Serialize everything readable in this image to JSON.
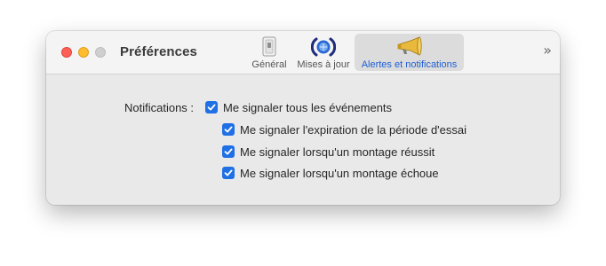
{
  "window": {
    "title": "Préférences"
  },
  "toolbar": {
    "tabs": [
      {
        "label": "Général",
        "icon": "switch-icon",
        "selected": false
      },
      {
        "label": "Mises à jour",
        "icon": "update-globe-icon",
        "selected": false
      },
      {
        "label": "Alertes et notifications",
        "icon": "megaphone-icon",
        "selected": true
      }
    ],
    "more_icon": "chevron-double-right-icon"
  },
  "notifications": {
    "label": "Notifications :",
    "options": [
      {
        "label": "Me signaler tous les événements",
        "checked": true
      },
      {
        "label": "Me signaler l'expiration de la période d'essai",
        "checked": true
      },
      {
        "label": "Me signaler lorsqu'un montage réussit",
        "checked": true
      },
      {
        "label": "Me signaler lorsqu'un montage échoue",
        "checked": true
      }
    ]
  },
  "colors": {
    "accent": "#1f6fe5",
    "selected_tab_text": "#1f5fd6",
    "close": "#fe5f57",
    "minimize": "#febc2e",
    "zoom_inactive": "#cfcfcf",
    "megaphone": "#e8b93a"
  }
}
